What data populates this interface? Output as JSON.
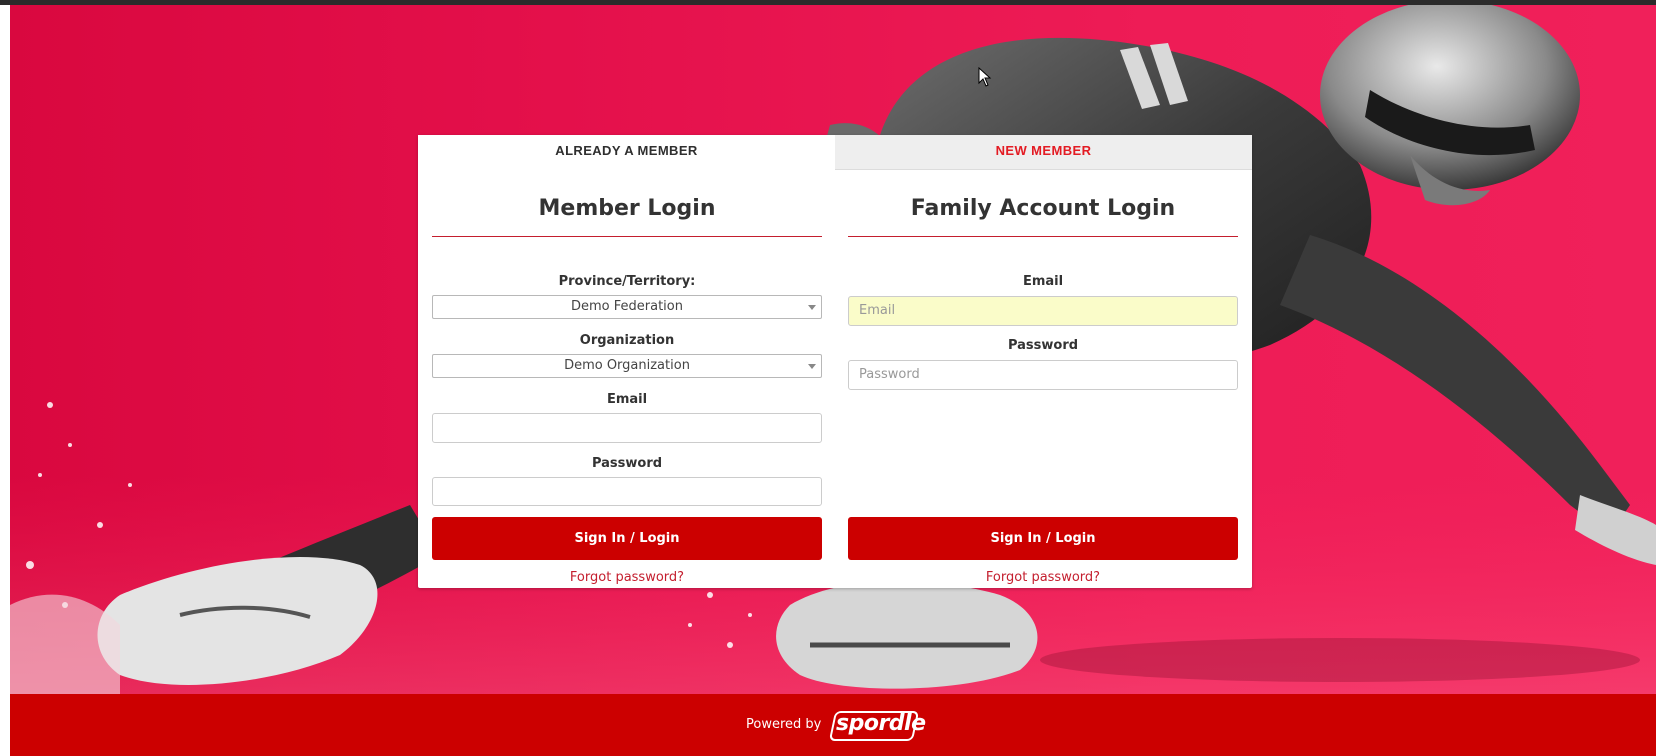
{
  "colors": {
    "background_red": "#e5124a",
    "button_red": "#cc0000",
    "link_red": "#c41e2e",
    "tab_active_text": "#2f2f2f",
    "tab_inactive_text": "#e31b23",
    "autofill_yellow": "#fafcc9"
  },
  "tabs": [
    {
      "label": "ALREADY A MEMBER",
      "active": true
    },
    {
      "label": "NEW MEMBER",
      "active": false
    }
  ],
  "member_login": {
    "title": "Member Login",
    "province_label": "Province/Territory:",
    "province_value": "Demo Federation",
    "organization_label": "Organization",
    "organization_value": "Demo Organization",
    "email_label": "Email",
    "email_value": "",
    "password_label": "Password",
    "password_value": "",
    "submit_label": "Sign In / Login",
    "forgot_label": "Forgot password?"
  },
  "family_login": {
    "title": "Family Account Login",
    "email_label": "Email",
    "email_placeholder": "Email",
    "password_label": "Password",
    "password_placeholder": "Password",
    "submit_label": "Sign In / Login",
    "forgot_label": "Forgot password?"
  },
  "footer": {
    "powered_by": "Powered by",
    "brand": "spordle"
  },
  "icons": {
    "select_caret": "chevron-down-icon",
    "cursor": "mouse-pointer-icon"
  }
}
